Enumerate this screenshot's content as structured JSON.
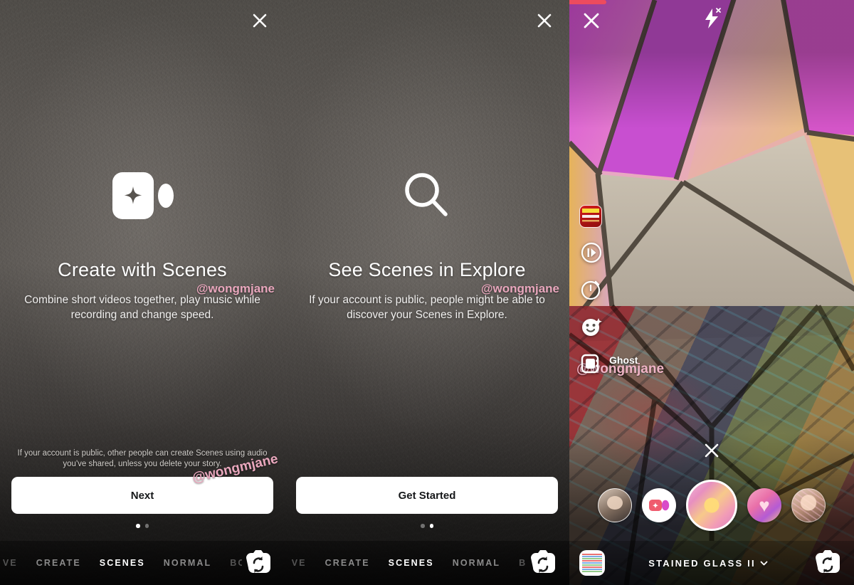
{
  "watermark": "@wongmjane",
  "panels": [
    {
      "id": "create-with-scenes",
      "close_label": "close-icon",
      "hero_icon": "video-sparkle-icon",
      "title": "Create with Scenes",
      "subtitle": "Combine short videos together, play music while recording and change speed.",
      "disclaimer": "If your account is public, other people can create Scenes using audio you've shared, unless you delete your story.",
      "cta": "Next",
      "dots": {
        "count": 2,
        "active": 0
      },
      "modebar": {
        "modes": [
          "VE",
          "CREATE",
          "SCENES",
          "NORMAL",
          "BO"
        ],
        "active": "SCENES",
        "flip_label": "flip-camera-icon"
      }
    },
    {
      "id": "see-scenes-in-explore",
      "close_label": "close-icon",
      "hero_icon": "search-icon",
      "title": "See Scenes in Explore",
      "subtitle": "If your account is public, people might be able to discover your Scenes in Explore.",
      "disclaimer": "",
      "cta": "Get Started",
      "dots": {
        "count": 2,
        "active": 1
      },
      "modebar": {
        "modes": [
          "VE",
          "CREATE",
          "SCENES",
          "NORMAL",
          "B"
        ],
        "active": "SCENES",
        "flip_label": "flip-camera-icon"
      }
    }
  ],
  "camera": {
    "recording_progress_pct": 13,
    "close_label": "close-icon",
    "flash_label": "flash-off-icon",
    "sidebar": [
      {
        "name": "music-album-thumbnail",
        "label": ""
      },
      {
        "name": "speed-icon",
        "label": ""
      },
      {
        "name": "timer-icon",
        "label": ""
      },
      {
        "name": "face-effects-icon",
        "label": ""
      },
      {
        "name": "ghost-icon",
        "label": "Ghost"
      }
    ],
    "clear_filter_label": "close-icon",
    "filters": [
      {
        "name": "person-thumbnail",
        "selected": false,
        "style": "th-person"
      },
      {
        "name": "create-scene-button",
        "selected": false,
        "style": "white-btn"
      },
      {
        "name": "stained-glass-filter",
        "selected": true,
        "style": "th-stained"
      },
      {
        "name": "hearts-filter",
        "selected": false,
        "style": "th-hearts"
      },
      {
        "name": "face-filter",
        "selected": false,
        "style": "th-face"
      }
    ],
    "gallery_label": "gallery-icon",
    "active_filter_name": "STAINED GLASS II",
    "chevron_label": "chevron-down-icon",
    "flip_label": "flip-camera-icon"
  },
  "colors": {
    "accent_pink": "#e9a7bd",
    "record_red": "#ed4b5e",
    "cta_bg": "#ffffff",
    "cta_text": "#16181a"
  }
}
